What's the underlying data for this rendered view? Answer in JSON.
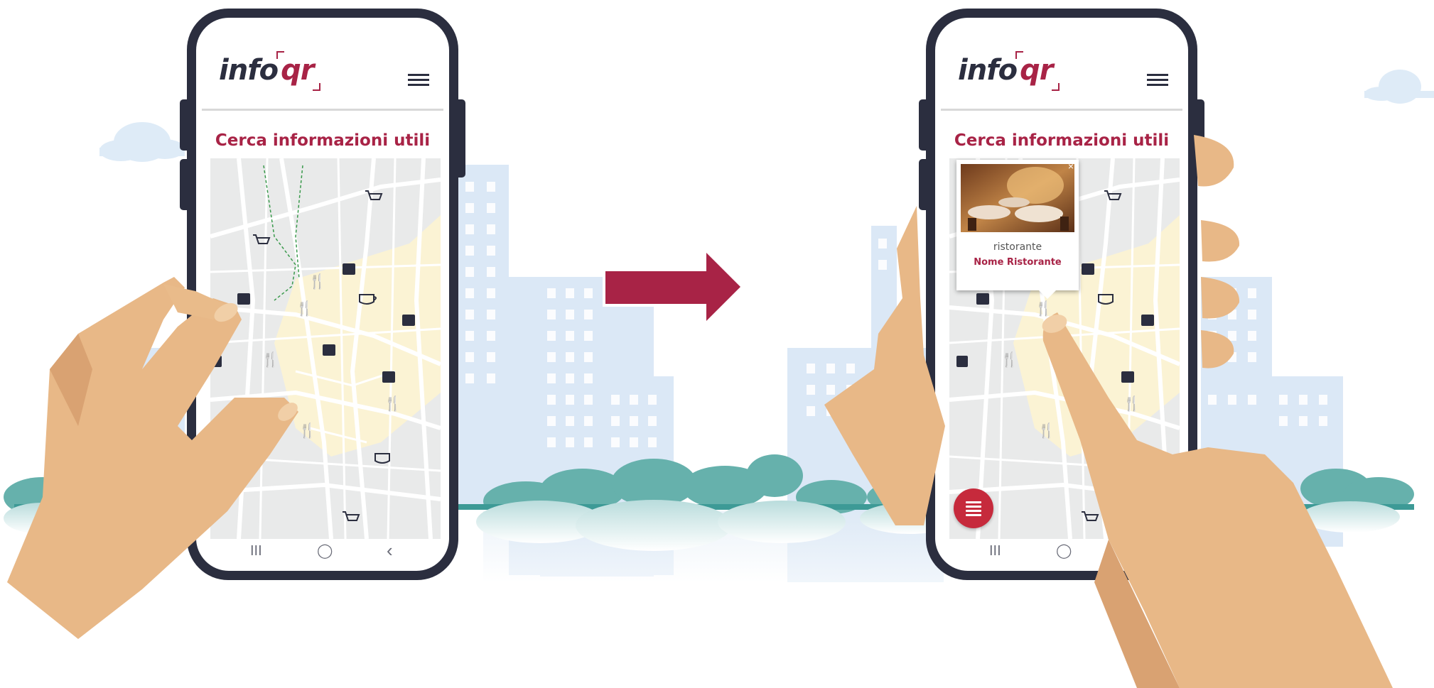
{
  "brand": {
    "logo_part1": "info",
    "logo_part2": "qr",
    "accent_color": "#a82346",
    "dark_color": "#2b2e3f"
  },
  "phone_left": {
    "title": "Cerca informazioni utili",
    "menu_icon": "hamburger-menu-icon",
    "nav_buttons": [
      "III",
      "◯",
      "‹"
    ],
    "map_pois": [
      "restaurant",
      "shopping-bag",
      "cart",
      "cafe"
    ]
  },
  "phone_right": {
    "title": "Cerca informazioni utili",
    "menu_icon": "hamburger-menu-icon",
    "nav_buttons": [
      "III",
      "◯"
    ],
    "popup": {
      "type": "ristorante",
      "name": "Nome Ristorante",
      "close_icon": "×"
    },
    "fab_icon": "list-icon"
  },
  "arrow": {
    "direction": "right",
    "color": "#a82346"
  }
}
